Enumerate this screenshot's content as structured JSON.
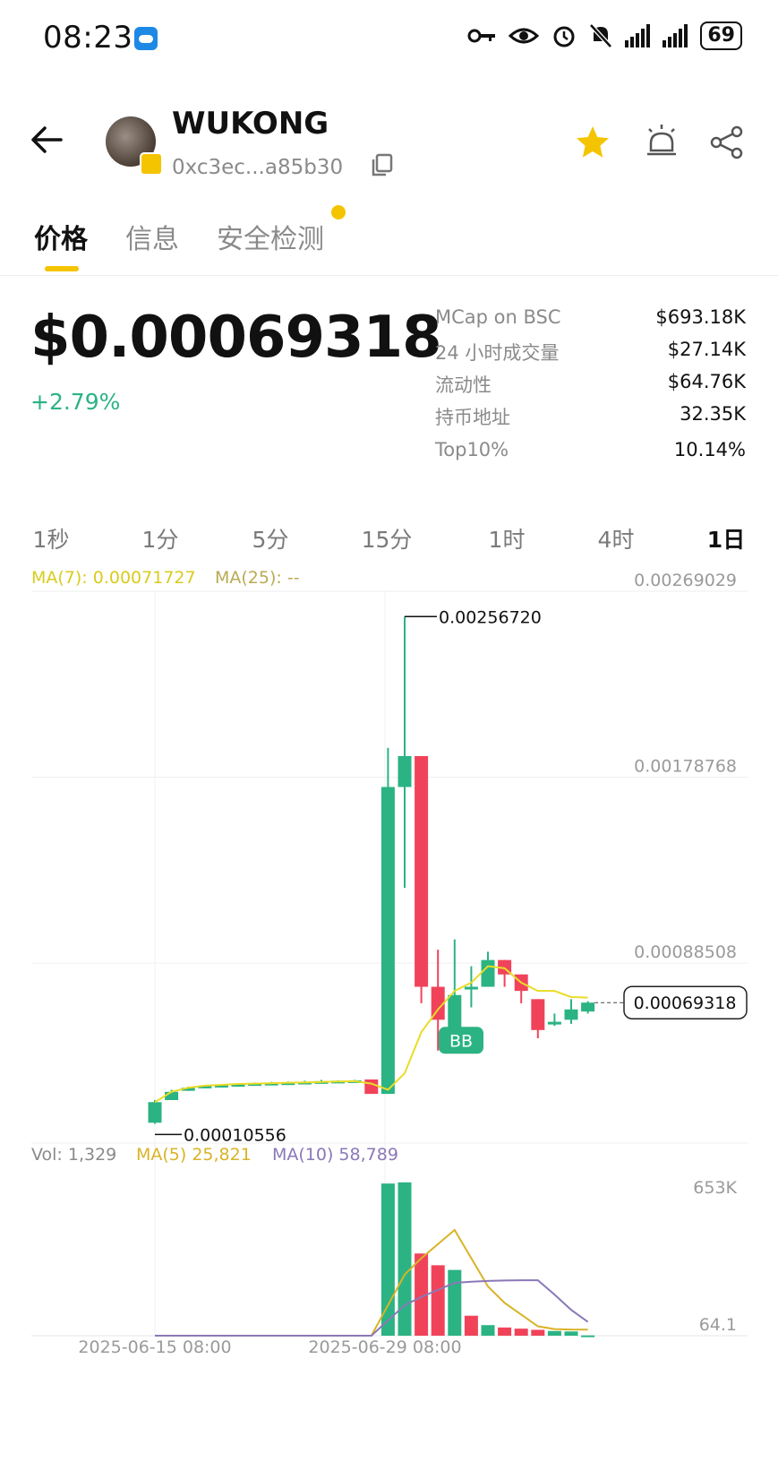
{
  "status_bar": {
    "time": "08:23",
    "battery": "69",
    "icons": [
      "weather-icon",
      "key-icon",
      "eye-icon",
      "alarm-icon",
      "mute-icon",
      "signal-icon",
      "signal-icon",
      "battery-icon"
    ]
  },
  "header": {
    "token_name": "WUKONG",
    "token_address": "0xc3ec...a85b30",
    "icons": [
      "back-arrow-icon",
      "copy-icon",
      "star-icon",
      "alarm-bell-icon",
      "share-icon"
    ]
  },
  "tabs": [
    {
      "label": "价格",
      "active": true
    },
    {
      "label": "信息",
      "active": false
    },
    {
      "label": "安全检测",
      "active": false
    }
  ],
  "price": {
    "value": "$0.00069318",
    "change": "+2.79%"
  },
  "stats": [
    {
      "label": "MCap on BSC",
      "value": "$693.18K"
    },
    {
      "label": "24 小时成交量",
      "value": "$27.14K"
    },
    {
      "label": "流动性",
      "value": "$64.76K"
    },
    {
      "label": "持币地址",
      "value": "32.35K"
    },
    {
      "label": "Top10%",
      "value": "10.14%"
    }
  ],
  "intervals": [
    {
      "label": "1秒",
      "active": false
    },
    {
      "label": "1分",
      "active": false
    },
    {
      "label": "5分",
      "active": false
    },
    {
      "label": "15分",
      "active": false
    },
    {
      "label": "1时",
      "active": false
    },
    {
      "label": "4时",
      "active": false
    },
    {
      "label": "1日",
      "active": true
    }
  ],
  "colors": {
    "up": "#2bb383",
    "down": "#f0435a",
    "accent": "#f5c400",
    "ma_yellow": "#e9dc26",
    "ma5": "#d9b327",
    "ma10": "#8b78b8"
  },
  "chart_data": [
    {
      "type": "candlestick",
      "legend": [
        "MA(7): 0.00071727",
        "MA(25): --"
      ],
      "y_ticks": [
        "0.00269029",
        "0.00178768",
        "0.00088508"
      ],
      "ylim": [
        1.12e-05,
        0.00269029
      ],
      "high_label": "0.00256720",
      "low_label": "0.00010556",
      "current_label": "0.00069318",
      "marker_label": "BB",
      "candles": [
        {
          "open": 0.00011,
          "high": 0.00022,
          "low": 0.000105,
          "close": 0.00021
        },
        {
          "open": 0.00022,
          "high": 0.00027,
          "low": 0.00022,
          "close": 0.00026
        },
        {
          "open": 0.000265,
          "high": 0.000285,
          "low": 0.000265,
          "close": 0.00028
        },
        {
          "open": 0.000282,
          "high": 0.000292,
          "low": 0.00028,
          "close": 0.00029
        },
        {
          "open": 0.00029,
          "high": 0.000295,
          "low": 0.000288,
          "close": 0.000294
        },
        {
          "open": 0.000294,
          "high": 0.000302,
          "low": 0.000292,
          "close": 0.000298
        },
        {
          "open": 0.000298,
          "high": 0.000305,
          "low": 0.000296,
          "close": 0.000302
        },
        {
          "open": 0.000302,
          "high": 0.000308,
          "low": 0.0003,
          "close": 0.000304
        },
        {
          "open": 0.000304,
          "high": 0.00031,
          "low": 0.000303,
          "close": 0.000306
        },
        {
          "open": 0.000306,
          "high": 0.000314,
          "low": 0.000305,
          "close": 0.000309
        },
        {
          "open": 0.000309,
          "high": 0.000318,
          "low": 0.000308,
          "close": 0.000312
        },
        {
          "open": 0.000312,
          "high": 0.000316,
          "low": 0.00031,
          "close": 0.000314
        },
        {
          "open": 0.000314,
          "high": 0.000318,
          "low": 0.000312,
          "close": 0.000316
        },
        {
          "open": 0.00032,
          "high": 0.00032,
          "low": 0.00025,
          "close": 0.00025
        },
        {
          "open": 0.00025,
          "high": 0.00193,
          "low": 0.00025,
          "close": 0.00174
        },
        {
          "open": 0.00174,
          "high": 0.0025672,
          "low": 0.00125,
          "close": 0.00189
        },
        {
          "open": 0.00189,
          "high": 0.00171,
          "low": 0.00069,
          "close": 0.00077
        },
        {
          "open": 0.00077,
          "high": 0.00095,
          "low": 0.00046,
          "close": 0.00061
        },
        {
          "open": 0.00052,
          "high": 0.001,
          "low": 0.00052,
          "close": 0.00073
        },
        {
          "open": 0.00077,
          "high": 0.00087,
          "low": 0.00067,
          "close": 0.00077
        },
        {
          "open": 0.00077,
          "high": 0.00094,
          "low": 0.00077,
          "close": 0.0009
        },
        {
          "open": 0.0009,
          "high": 0.00084,
          "low": 0.00077,
          "close": 0.00083
        },
        {
          "open": 0.00083,
          "high": 0.0008,
          "low": 0.00069,
          "close": 0.00075
        },
        {
          "open": 0.00071,
          "high": 0.00071,
          "low": 0.00052,
          "close": 0.00056
        },
        {
          "open": 0.00059,
          "high": 0.00064,
          "low": 0.00058,
          "close": 0.0006
        },
        {
          "open": 0.00061,
          "high": 0.00071,
          "low": 0.00059,
          "close": 0.00066
        },
        {
          "open": 0.00065,
          "high": 0.0007,
          "low": 0.00064,
          "close": 0.00069318
        }
      ],
      "ma7": [
        0.00021,
        0.00026,
        0.00028,
        0.00029,
        0.000294,
        0.000298,
        0.0003,
        0.000302,
        0.000304,
        0.000306,
        0.000308,
        0.00031,
        0.000312,
        0.0003,
        0.00027,
        0.00035,
        0.00055,
        0.00066,
        0.00075,
        0.00079,
        0.00087,
        0.00086,
        0.00079,
        0.00075,
        0.00075,
        0.00072,
        0.00071727
      ]
    },
    {
      "type": "bar",
      "legend": [
        "Vol: 1,329",
        "MA(5) 25,821",
        "MA(10) 58,789"
      ],
      "y_ticks": [
        "653K",
        "64.1"
      ],
      "x_ticks": [
        "2025-06-15 08:00",
        "2025-06-29 08:00"
      ],
      "bars": [
        {
          "value": 0,
          "dir": "up"
        },
        {
          "value": 0,
          "dir": "up"
        },
        {
          "value": 0,
          "dir": "up"
        },
        {
          "value": 0,
          "dir": "up"
        },
        {
          "value": 0,
          "dir": "up"
        },
        {
          "value": 0,
          "dir": "up"
        },
        {
          "value": 0,
          "dir": "up"
        },
        {
          "value": 0,
          "dir": "up"
        },
        {
          "value": 0,
          "dir": "up"
        },
        {
          "value": 0,
          "dir": "up"
        },
        {
          "value": 0,
          "dir": "up"
        },
        {
          "value": 0,
          "dir": "up"
        },
        {
          "value": 0,
          "dir": "up"
        },
        {
          "value": 0,
          "dir": "down"
        },
        {
          "value": 648000,
          "dir": "up"
        },
        {
          "value": 653000,
          "dir": "up"
        },
        {
          "value": 350000,
          "dir": "down"
        },
        {
          "value": 300000,
          "dir": "down"
        },
        {
          "value": 280000,
          "dir": "up"
        },
        {
          "value": 85000,
          "dir": "down"
        },
        {
          "value": 45000,
          "dir": "up"
        },
        {
          "value": 35000,
          "dir": "down"
        },
        {
          "value": 30000,
          "dir": "down"
        },
        {
          "value": 25000,
          "dir": "down"
        },
        {
          "value": 20000,
          "dir": "up"
        },
        {
          "value": 18000,
          "dir": "up"
        },
        {
          "value": 1329,
          "dir": "up"
        }
      ],
      "ma5": [
        0,
        0,
        0,
        0,
        0,
        0,
        0,
        0,
        0,
        0,
        0,
        0,
        0,
        0,
        130000,
        260000,
        330000,
        390000,
        450000,
        330000,
        210000,
        140000,
        90000,
        40000,
        28000,
        26000,
        25821
      ],
      "ma10": [
        0,
        0,
        0,
        0,
        0,
        0,
        0,
        0,
        0,
        0,
        0,
        0,
        0,
        0,
        65000,
        130000,
        165000,
        195000,
        225000,
        230000,
        233000,
        235000,
        236000,
        236000,
        175000,
        110000,
        58789
      ]
    }
  ]
}
